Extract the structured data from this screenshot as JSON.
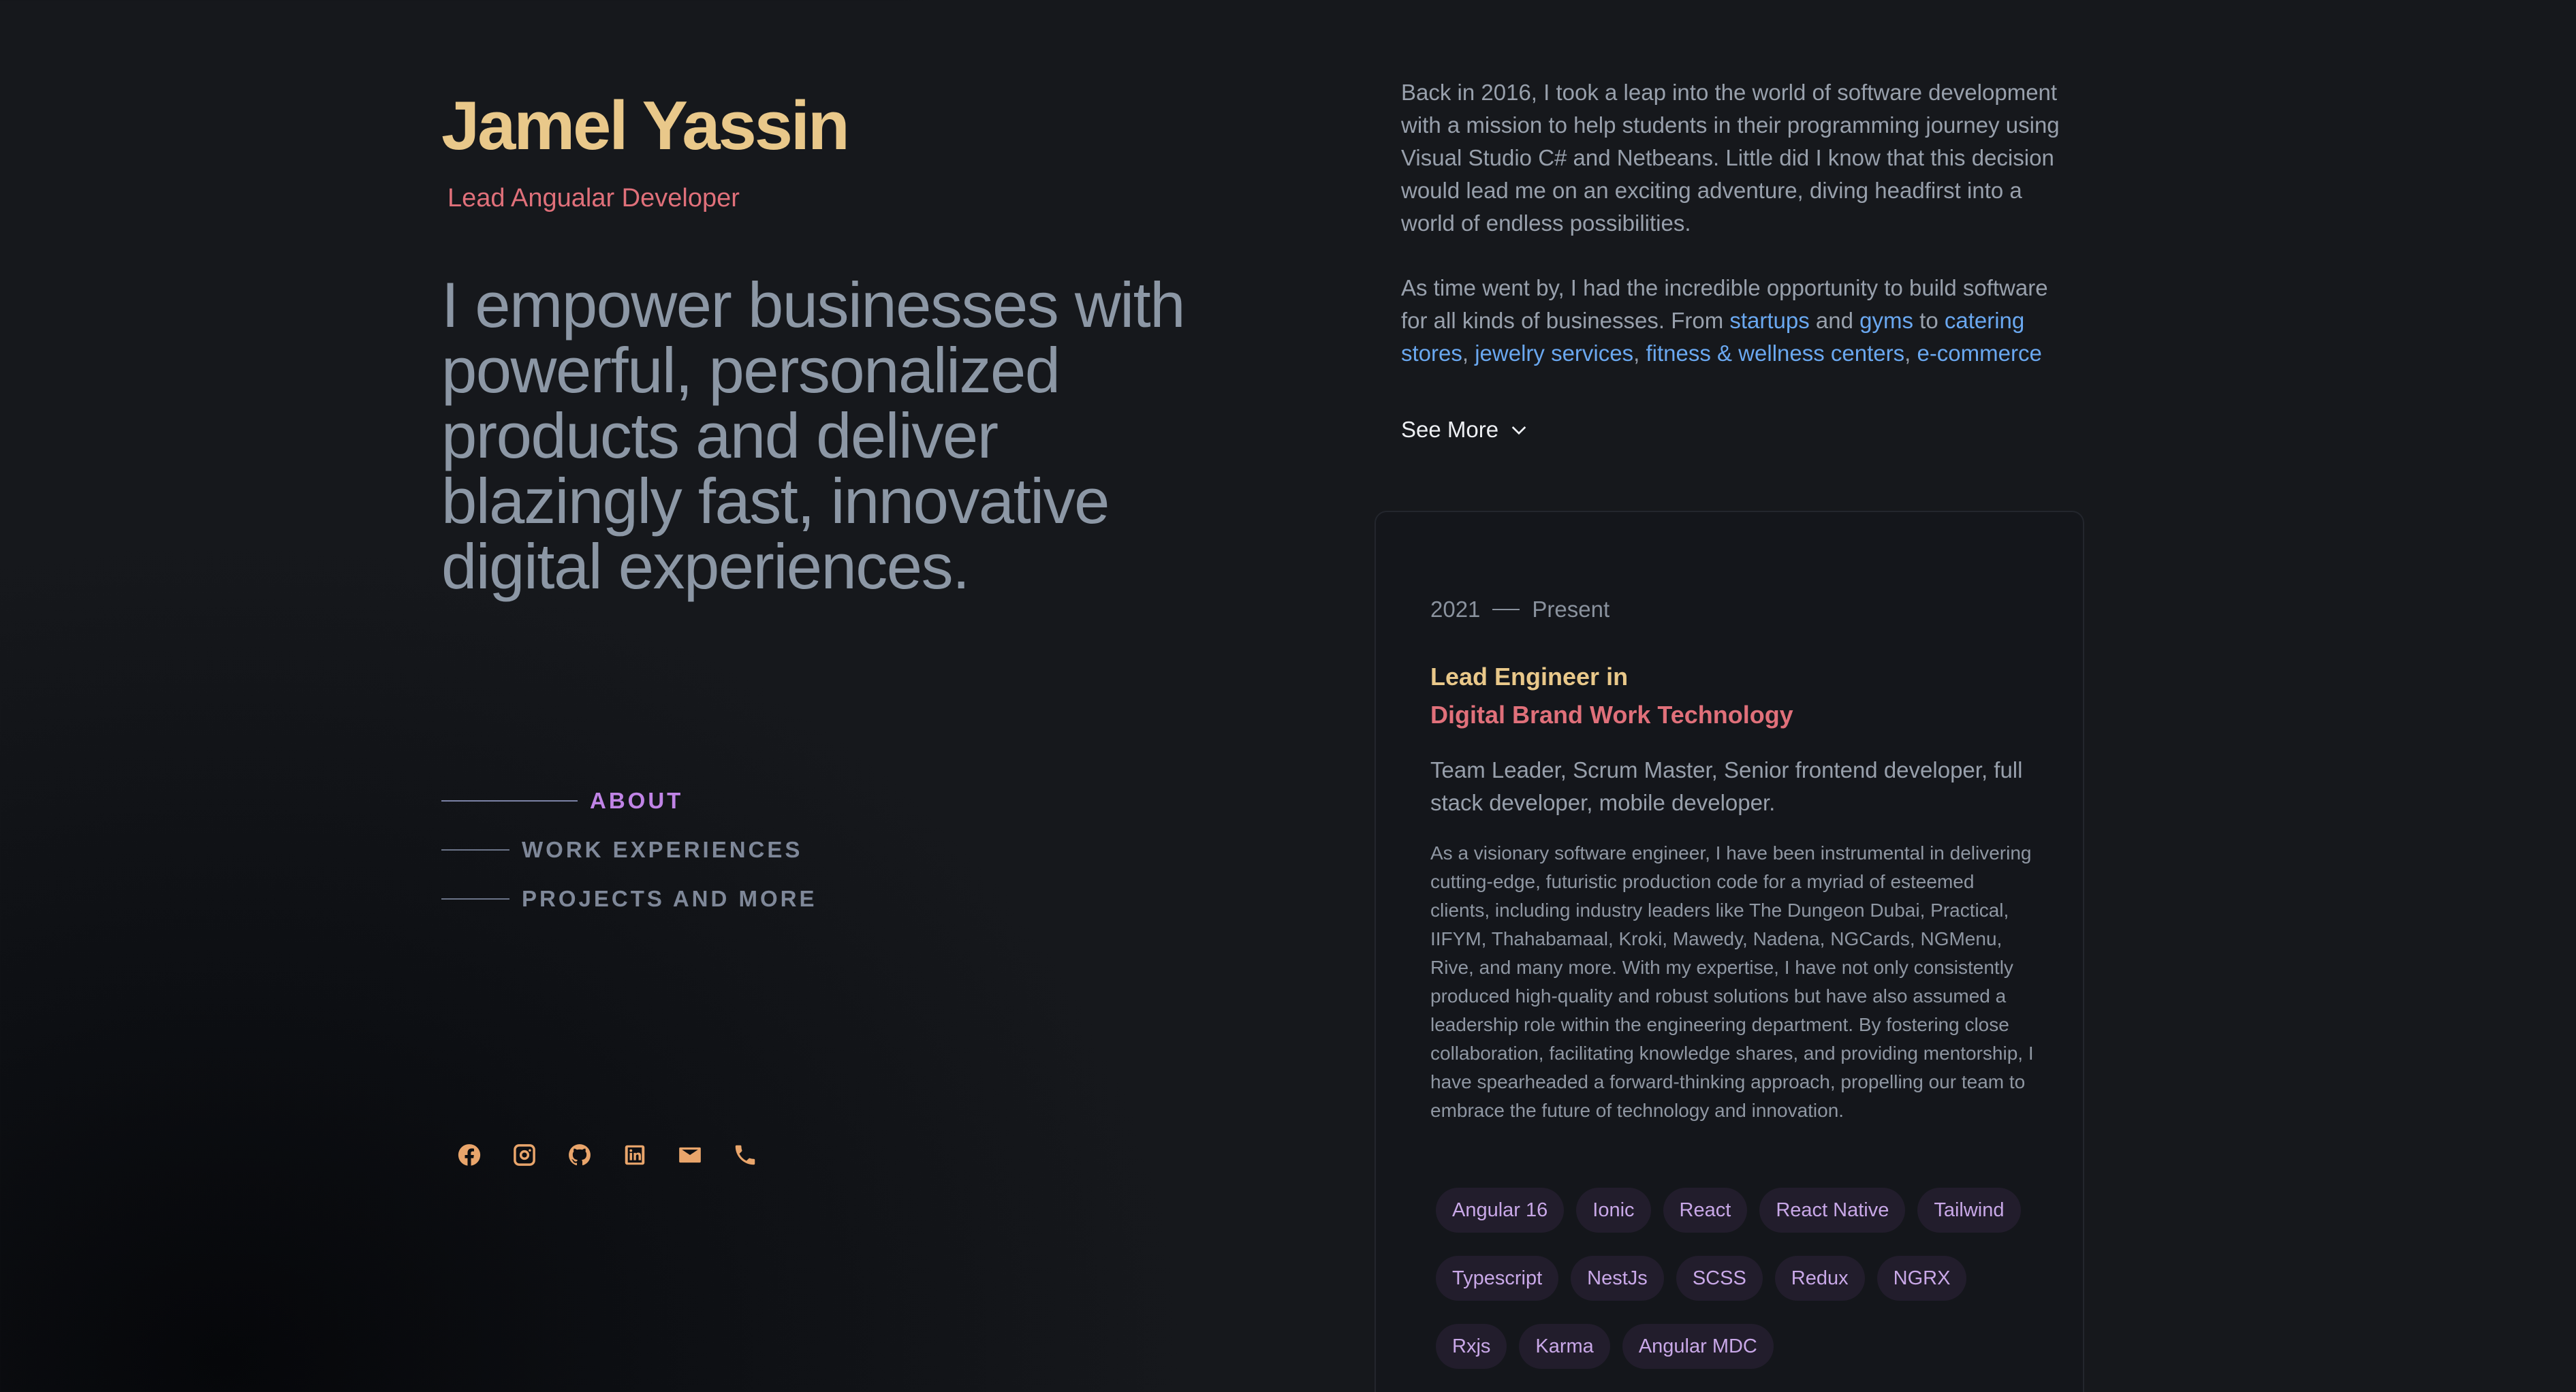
{
  "profile": {
    "name": "Jamel Yassin",
    "role": "Lead Angualar Developer",
    "headline": "I empower businesses with powerful, personalized products and deliver blazingly fast, innovative digital experiences."
  },
  "nav": {
    "items": [
      {
        "label": "ABOUT",
        "active": true
      },
      {
        "label": "WORK EXPERIENCES",
        "active": false
      },
      {
        "label": "PROJECTS AND MORE",
        "active": false
      }
    ]
  },
  "socials": [
    {
      "icon": "facebook-icon"
    },
    {
      "icon": "instagram-icon"
    },
    {
      "icon": "github-icon"
    },
    {
      "icon": "linkedin-icon"
    },
    {
      "icon": "mail-icon"
    },
    {
      "icon": "phone-icon"
    }
  ],
  "about": {
    "p1": "Back in 2016, I took a leap into the world of software development with a mission to help students in their programming journey using Visual Studio C# and Netbeans. Little did I know that this decision would lead me on an exciting adventure, diving headfirst into a world of endless possibilities.",
    "p2_intro": "As time went by, I had the incredible opportunity to build software for all kinds of businesses. From ",
    "link_startups": "startups",
    "and": " and ",
    "link_gyms": "gyms",
    "to": " to ",
    "link_catering": "catering stores",
    "comma1": ", ",
    "link_jewelry": "jewelry services",
    "comma2": ", ",
    "link_fitness": "fitness & wellness centers",
    "comma3": ", ",
    "link_ecommerce": "e-commerce",
    "see_more": "See More"
  },
  "experience": {
    "start": "2021",
    "end": "Present",
    "title_line1": "Lead Engineer in",
    "title_line2": "Digital Brand Work Technology",
    "roles": "Team Leader, Scrum Master, Senior frontend developer, full stack developer, mobile developer.",
    "description": "As a visionary software engineer, I have been instrumental in delivering cutting-edge, futuristic production code for a myriad of esteemed clients, including industry leaders like The Dungeon Dubai, Practical, IIFYM, Thahabamaal, Kroki, Mawedy, Nadena, NGCards, NGMenu, Rive, and many more. With my expertise, I have not only consistently produced high-quality and robust solutions but have also assumed a leadership role within the engineering department. By fostering close collaboration, facilitating knowledge shares, and providing mentorship, I have spearheaded a forward-thinking approach, propelling our team to embrace the future of technology and innovation.",
    "tags": [
      "Angular 16",
      "Ionic",
      "React",
      "React Native",
      "Tailwind",
      "Typescript",
      "NestJs",
      "SCSS",
      "Redux",
      "NGRX",
      "Rxjs",
      "Karma",
      "Angular MDC"
    ]
  },
  "colors": {
    "name": "#e9c88a",
    "accent_red": "#e0707a",
    "link": "#6aa8f0",
    "nav_active": "#c084e6",
    "icon": "#e9a56b",
    "tag_text": "#c9a8e8"
  }
}
